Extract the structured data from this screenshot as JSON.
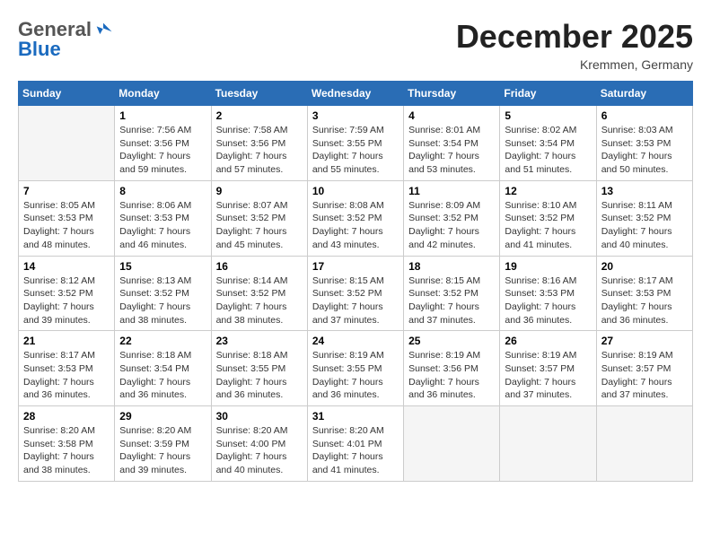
{
  "header": {
    "logo": {
      "general": "General",
      "blue": "Blue"
    },
    "title": "December 2025",
    "location": "Kremmen, Germany"
  },
  "calendar": {
    "weekdays": [
      "Sunday",
      "Monday",
      "Tuesday",
      "Wednesday",
      "Thursday",
      "Friday",
      "Saturday"
    ],
    "weeks": [
      [
        {
          "day": "",
          "info": ""
        },
        {
          "day": "1",
          "info": "Sunrise: 7:56 AM\nSunset: 3:56 PM\nDaylight: 7 hours\nand 59 minutes."
        },
        {
          "day": "2",
          "info": "Sunrise: 7:58 AM\nSunset: 3:56 PM\nDaylight: 7 hours\nand 57 minutes."
        },
        {
          "day": "3",
          "info": "Sunrise: 7:59 AM\nSunset: 3:55 PM\nDaylight: 7 hours\nand 55 minutes."
        },
        {
          "day": "4",
          "info": "Sunrise: 8:01 AM\nSunset: 3:54 PM\nDaylight: 7 hours\nand 53 minutes."
        },
        {
          "day": "5",
          "info": "Sunrise: 8:02 AM\nSunset: 3:54 PM\nDaylight: 7 hours\nand 51 minutes."
        },
        {
          "day": "6",
          "info": "Sunrise: 8:03 AM\nSunset: 3:53 PM\nDaylight: 7 hours\nand 50 minutes."
        }
      ],
      [
        {
          "day": "7",
          "info": "Sunrise: 8:05 AM\nSunset: 3:53 PM\nDaylight: 7 hours\nand 48 minutes."
        },
        {
          "day": "8",
          "info": "Sunrise: 8:06 AM\nSunset: 3:53 PM\nDaylight: 7 hours\nand 46 minutes."
        },
        {
          "day": "9",
          "info": "Sunrise: 8:07 AM\nSunset: 3:52 PM\nDaylight: 7 hours\nand 45 minutes."
        },
        {
          "day": "10",
          "info": "Sunrise: 8:08 AM\nSunset: 3:52 PM\nDaylight: 7 hours\nand 43 minutes."
        },
        {
          "day": "11",
          "info": "Sunrise: 8:09 AM\nSunset: 3:52 PM\nDaylight: 7 hours\nand 42 minutes."
        },
        {
          "day": "12",
          "info": "Sunrise: 8:10 AM\nSunset: 3:52 PM\nDaylight: 7 hours\nand 41 minutes."
        },
        {
          "day": "13",
          "info": "Sunrise: 8:11 AM\nSunset: 3:52 PM\nDaylight: 7 hours\nand 40 minutes."
        }
      ],
      [
        {
          "day": "14",
          "info": "Sunrise: 8:12 AM\nSunset: 3:52 PM\nDaylight: 7 hours\nand 39 minutes."
        },
        {
          "day": "15",
          "info": "Sunrise: 8:13 AM\nSunset: 3:52 PM\nDaylight: 7 hours\nand 38 minutes."
        },
        {
          "day": "16",
          "info": "Sunrise: 8:14 AM\nSunset: 3:52 PM\nDaylight: 7 hours\nand 38 minutes."
        },
        {
          "day": "17",
          "info": "Sunrise: 8:15 AM\nSunset: 3:52 PM\nDaylight: 7 hours\nand 37 minutes."
        },
        {
          "day": "18",
          "info": "Sunrise: 8:15 AM\nSunset: 3:52 PM\nDaylight: 7 hours\nand 37 minutes."
        },
        {
          "day": "19",
          "info": "Sunrise: 8:16 AM\nSunset: 3:53 PM\nDaylight: 7 hours\nand 36 minutes."
        },
        {
          "day": "20",
          "info": "Sunrise: 8:17 AM\nSunset: 3:53 PM\nDaylight: 7 hours\nand 36 minutes."
        }
      ],
      [
        {
          "day": "21",
          "info": "Sunrise: 8:17 AM\nSunset: 3:53 PM\nDaylight: 7 hours\nand 36 minutes."
        },
        {
          "day": "22",
          "info": "Sunrise: 8:18 AM\nSunset: 3:54 PM\nDaylight: 7 hours\nand 36 minutes."
        },
        {
          "day": "23",
          "info": "Sunrise: 8:18 AM\nSunset: 3:55 PM\nDaylight: 7 hours\nand 36 minutes."
        },
        {
          "day": "24",
          "info": "Sunrise: 8:19 AM\nSunset: 3:55 PM\nDaylight: 7 hours\nand 36 minutes."
        },
        {
          "day": "25",
          "info": "Sunrise: 8:19 AM\nSunset: 3:56 PM\nDaylight: 7 hours\nand 36 minutes."
        },
        {
          "day": "26",
          "info": "Sunrise: 8:19 AM\nSunset: 3:57 PM\nDaylight: 7 hours\nand 37 minutes."
        },
        {
          "day": "27",
          "info": "Sunrise: 8:19 AM\nSunset: 3:57 PM\nDaylight: 7 hours\nand 37 minutes."
        }
      ],
      [
        {
          "day": "28",
          "info": "Sunrise: 8:20 AM\nSunset: 3:58 PM\nDaylight: 7 hours\nand 38 minutes."
        },
        {
          "day": "29",
          "info": "Sunrise: 8:20 AM\nSunset: 3:59 PM\nDaylight: 7 hours\nand 39 minutes."
        },
        {
          "day": "30",
          "info": "Sunrise: 8:20 AM\nSunset: 4:00 PM\nDaylight: 7 hours\nand 40 minutes."
        },
        {
          "day": "31",
          "info": "Sunrise: 8:20 AM\nSunset: 4:01 PM\nDaylight: 7 hours\nand 41 minutes."
        },
        {
          "day": "",
          "info": ""
        },
        {
          "day": "",
          "info": ""
        },
        {
          "day": "",
          "info": ""
        }
      ]
    ]
  }
}
